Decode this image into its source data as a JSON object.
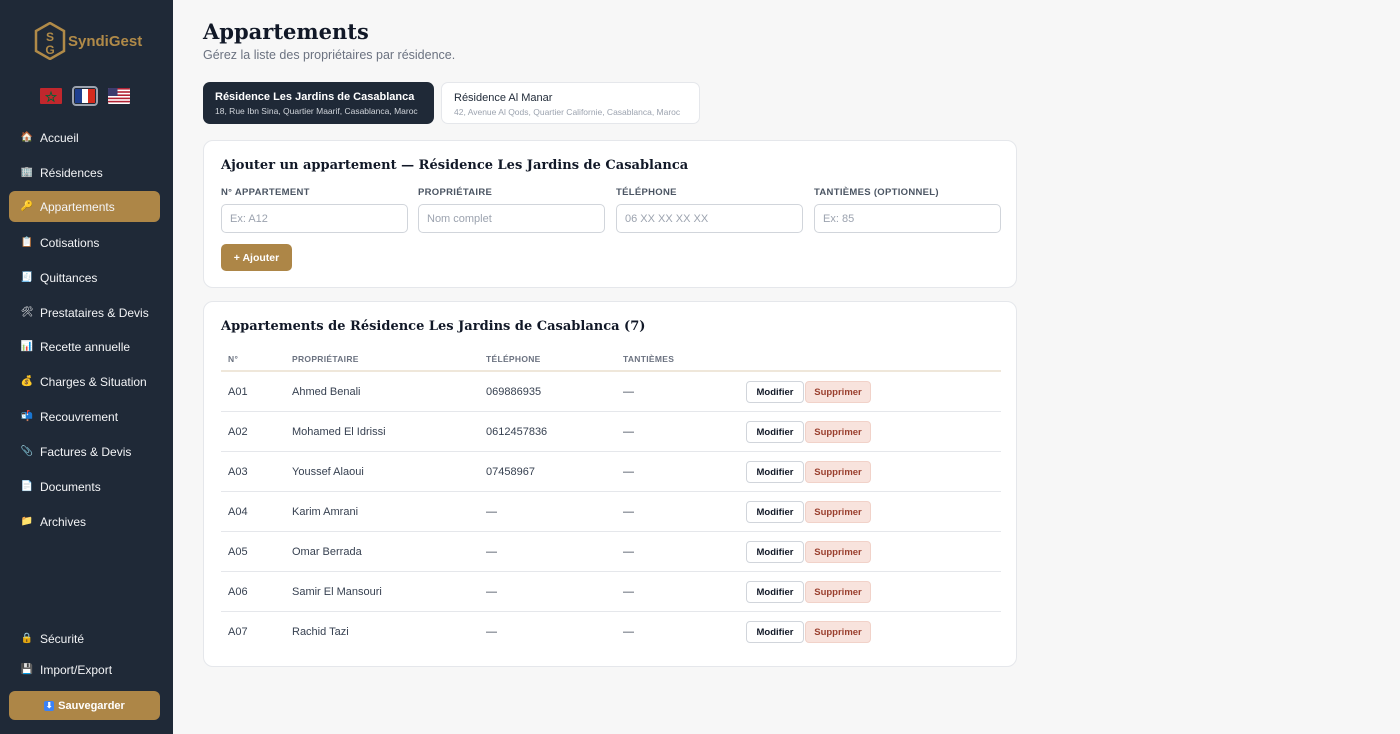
{
  "app": {
    "name": "SyndiGest"
  },
  "sidebar": {
    "items": [
      {
        "label": "Accueil",
        "icon": "house-icon",
        "glyph": "🏠",
        "active": false
      },
      {
        "label": "Résidences",
        "icon": "building-icon",
        "glyph": "🏢",
        "active": false
      },
      {
        "label": "Appartements",
        "icon": "key-icon",
        "glyph": "🔑",
        "active": true
      },
      {
        "label": "Cotisations",
        "icon": "clipboard-icon",
        "glyph": "📋",
        "active": false
      },
      {
        "label": "Quittances",
        "icon": "receipt-icon",
        "glyph": "🧾",
        "active": false
      },
      {
        "label": "Prestataires & Devis",
        "icon": "tools-icon",
        "glyph": "🛠",
        "active": false
      },
      {
        "label": "Recette annuelle",
        "icon": "bar-chart-icon",
        "glyph": "📊",
        "active": false
      },
      {
        "label": "Charges & Situation",
        "icon": "money-bag-icon",
        "glyph": "💰",
        "active": false
      },
      {
        "label": "Recouvrement",
        "icon": "mailbox-icon",
        "glyph": "📬",
        "active": false
      },
      {
        "label": "Factures & Devis",
        "icon": "paperclip-icon",
        "glyph": "📎",
        "active": false
      },
      {
        "label": "Documents",
        "icon": "document-icon",
        "glyph": "📄",
        "active": false
      },
      {
        "label": "Archives",
        "icon": "folder-icon",
        "glyph": "📁",
        "active": false
      }
    ],
    "bottom_items": [
      {
        "label": "Sécurité",
        "icon": "lock-icon",
        "glyph": "🔒"
      },
      {
        "label": "Import/Export",
        "icon": "floppy-disk-icon",
        "glyph": "💾"
      }
    ],
    "save_label": "Sauvegarder"
  },
  "header": {
    "title": "Appartements",
    "subtitle": "Gérez la liste des propriétaires par résidence."
  },
  "residences": [
    {
      "name": "Résidence Les Jardins de Casablanca",
      "address": "18, Rue Ibn Sina, Quartier Maarif, Casablanca, Maroc",
      "active": true
    },
    {
      "name": "Résidence Al Manar",
      "address": "42, Avenue Al Qods, Quartier Californie, Casablanca, Maroc",
      "active": false
    }
  ],
  "form": {
    "title": "Ajouter un appartement — Résidence Les Jardins de Casablanca",
    "fields": [
      {
        "label": "N° APPARTEMENT",
        "placeholder": "Ex: A12",
        "value": ""
      },
      {
        "label": "PROPRIÉTAIRE",
        "placeholder": "Nom complet",
        "value": ""
      },
      {
        "label": "TÉLÉPHONE",
        "placeholder": "06 XX XX XX XX",
        "value": ""
      },
      {
        "label": "TANTIÈMES (OPTIONNEL)",
        "placeholder": "Ex: 85",
        "value": ""
      }
    ],
    "add_label": "+ Ajouter"
  },
  "list": {
    "title": "Appartements de Résidence Les Jardins de Casablanca (7)",
    "columns": [
      "N°",
      "PROPRIÉTAIRE",
      "TÉLÉPHONE",
      "TANTIÈMES"
    ],
    "edit_label": "Modifier",
    "delete_label": "Supprimer",
    "rows": [
      {
        "num": "A01",
        "owner": "Ahmed Benali",
        "phone": "069886935",
        "tantiemes": "—"
      },
      {
        "num": "A02",
        "owner": "Mohamed El Idrissi",
        "phone": "0612457836",
        "tantiemes": "—"
      },
      {
        "num": "A03",
        "owner": "Youssef Alaoui",
        "phone": "07458967",
        "tantiemes": "—"
      },
      {
        "num": "A04",
        "owner": "Karim Amrani",
        "phone": "—",
        "tantiemes": "—"
      },
      {
        "num": "A05",
        "owner": "Omar Berrada",
        "phone": "—",
        "tantiemes": "—"
      },
      {
        "num": "A06",
        "owner": "Samir El Mansouri",
        "phone": "—",
        "tantiemes": "—"
      },
      {
        "num": "A07",
        "owner": "Rachid Tazi",
        "phone": "—",
        "tantiemes": "—"
      }
    ]
  },
  "colors": {
    "sidebar_bg": "#1f2937",
    "accent": "#ad8647",
    "danger_bg": "#f8e3dd",
    "danger_text": "#9a3f2e"
  }
}
